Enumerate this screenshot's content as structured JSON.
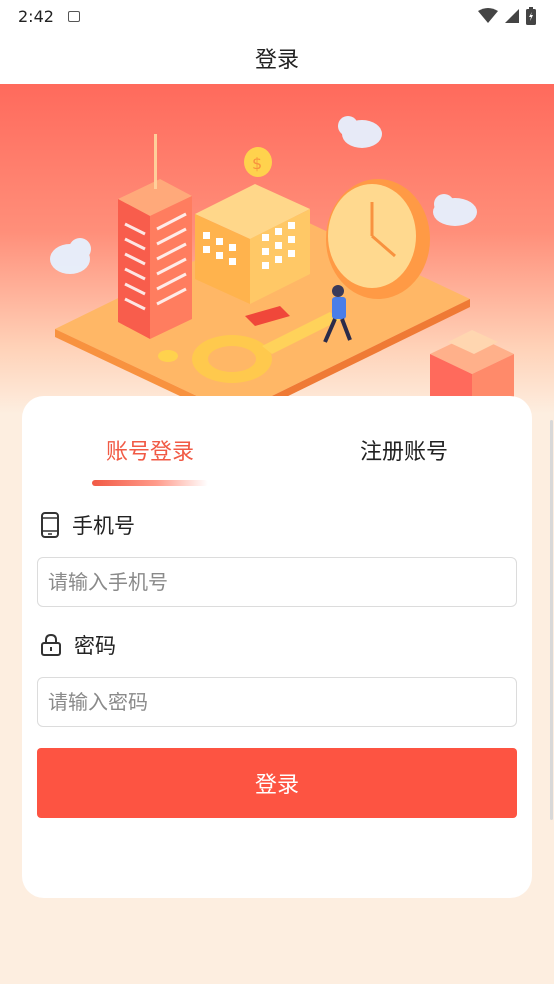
{
  "status_bar": {
    "time": "2:42",
    "icons": [
      "sim-card-icon",
      "wifi-icon",
      "signal-icon",
      "battery-icon"
    ]
  },
  "header": {
    "title": "登录"
  },
  "tabs": [
    {
      "label": "账号登录",
      "active": true
    },
    {
      "label": "注册账号",
      "active": false
    }
  ],
  "form": {
    "phone_label": "手机号",
    "phone_placeholder": "请输入手机号",
    "password_label": "密码",
    "password_placeholder": "请输入密码",
    "submit_label": "登录"
  },
  "colors": {
    "accent": "#f15a45",
    "button": "#fd5442",
    "page_bg": "#fdeee0"
  }
}
